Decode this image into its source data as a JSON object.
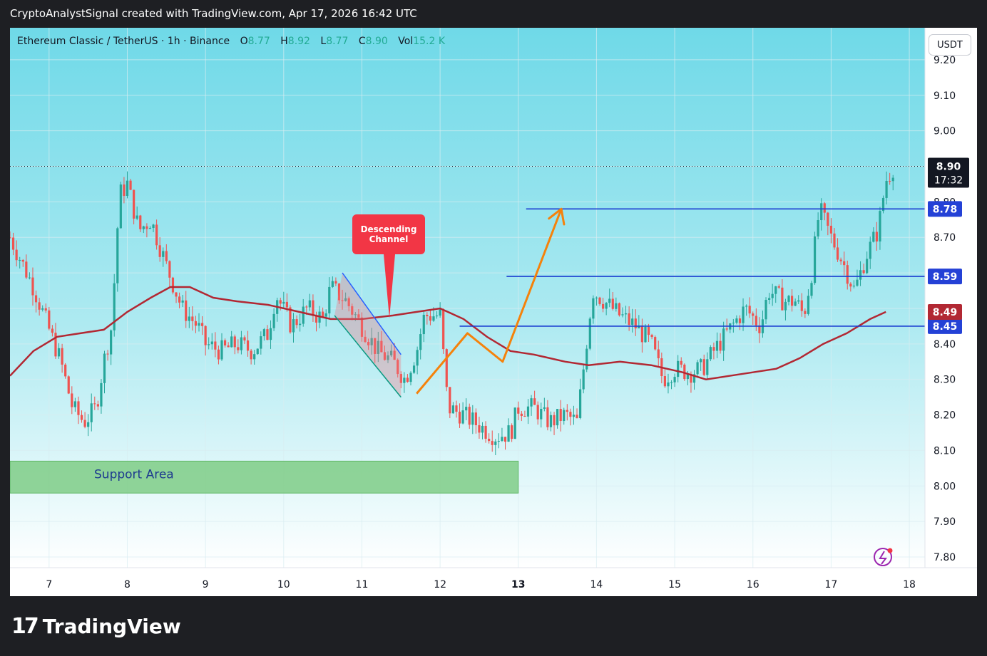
{
  "header": {
    "attribution": "CryptoAnalystSignal created with TradingView.com, Apr 17, 2026 16:42 UTC"
  },
  "legend": {
    "symbol": "Ethereum Classic / TetherUS · 1h · Binance",
    "o_label": "O",
    "o_value": "8.77",
    "h_label": "H",
    "h_value": "8.92",
    "l_label": "L",
    "l_value": "8.77",
    "c_label": "C",
    "c_value": "8.90",
    "vol_label": "Vol",
    "vol_value": "15.2 K"
  },
  "currency": "USDT",
  "logo": {
    "mark": "17",
    "text": "TradingView"
  },
  "colors": {
    "up": "#26a69a",
    "down": "#ef5350",
    "ma": "#b22833",
    "level": "#1c3fd1",
    "arrow": "#f5820b",
    "support": "#7fcc86",
    "bgTop": "#6fd9e8",
    "bgBottom": "#ffffff"
  },
  "chart_data": {
    "type": "candlestick",
    "ylim": [
      7.77,
      9.29
    ],
    "xlim": [
      6.5,
      18.2
    ],
    "y_ticks": [
      "9.20",
      "9.10",
      "9.00",
      "8.90",
      "8.80",
      "8.70",
      "8.60",
      "8.50",
      "8.40",
      "8.30",
      "8.20",
      "8.10",
      "8.00",
      "7.90",
      "7.80"
    ],
    "x_ticks": [
      {
        "x": 7,
        "label": "7"
      },
      {
        "x": 8,
        "label": "8"
      },
      {
        "x": 9,
        "label": "9"
      },
      {
        "x": 10,
        "label": "10"
      },
      {
        "x": 11,
        "label": "11"
      },
      {
        "x": 12,
        "label": "12"
      },
      {
        "x": 13,
        "label": "13"
      },
      {
        "x": 14,
        "label": "14"
      },
      {
        "x": 15,
        "label": "15"
      },
      {
        "x": 16,
        "label": "16"
      },
      {
        "x": 17,
        "label": "17"
      },
      {
        "x": 18,
        "label": "18"
      }
    ],
    "close_path": [
      [
        6.5,
        8.7
      ],
      [
        6.8,
        8.56
      ],
      [
        7.0,
        8.44
      ],
      [
        7.15,
        8.35
      ],
      [
        7.3,
        8.22
      ],
      [
        7.45,
        8.18
      ],
      [
        7.6,
        8.22
      ],
      [
        7.7,
        8.35
      ],
      [
        7.8,
        8.45
      ],
      [
        7.9,
        8.82
      ],
      [
        8.0,
        8.85
      ],
      [
        8.15,
        8.72
      ],
      [
        8.3,
        8.75
      ],
      [
        8.5,
        8.62
      ],
      [
        8.7,
        8.5
      ],
      [
        8.9,
        8.45
      ],
      [
        9.0,
        8.4
      ],
      [
        9.2,
        8.38
      ],
      [
        9.4,
        8.4
      ],
      [
        9.6,
        8.38
      ],
      [
        9.8,
        8.43
      ],
      [
        9.9,
        8.54
      ],
      [
        10.1,
        8.45
      ],
      [
        10.3,
        8.5
      ],
      [
        10.5,
        8.47
      ],
      [
        10.6,
        8.56
      ],
      [
        10.8,
        8.52
      ],
      [
        11.0,
        8.45
      ],
      [
        11.2,
        8.38
      ],
      [
        11.4,
        8.35
      ],
      [
        11.55,
        8.3
      ],
      [
        11.7,
        8.38
      ],
      [
        11.8,
        8.48
      ],
      [
        12.0,
        8.48
      ],
      [
        12.1,
        8.22
      ],
      [
        12.3,
        8.2
      ],
      [
        12.5,
        8.17
      ],
      [
        12.7,
        8.14
      ],
      [
        12.9,
        8.15
      ],
      [
        13.0,
        8.22
      ],
      [
        13.2,
        8.22
      ],
      [
        13.4,
        8.18
      ],
      [
        13.6,
        8.2
      ],
      [
        13.75,
        8.18
      ],
      [
        13.85,
        8.36
      ],
      [
        13.95,
        8.55
      ],
      [
        14.1,
        8.52
      ],
      [
        14.3,
        8.48
      ],
      [
        14.5,
        8.45
      ],
      [
        14.7,
        8.4
      ],
      [
        14.85,
        8.3
      ],
      [
        15.0,
        8.33
      ],
      [
        15.2,
        8.32
      ],
      [
        15.35,
        8.33
      ],
      [
        15.5,
        8.38
      ],
      [
        15.7,
        8.44
      ],
      [
        15.9,
        8.5
      ],
      [
        16.1,
        8.45
      ],
      [
        16.2,
        8.55
      ],
      [
        16.4,
        8.52
      ],
      [
        16.55,
        8.52
      ],
      [
        16.65,
        8.48
      ],
      [
        16.75,
        8.6
      ],
      [
        16.85,
        8.78
      ],
      [
        17.0,
        8.7
      ],
      [
        17.15,
        8.63
      ],
      [
        17.3,
        8.55
      ],
      [
        17.45,
        8.65
      ],
      [
        17.6,
        8.72
      ],
      [
        17.7,
        8.86
      ],
      [
        17.8,
        8.9
      ]
    ],
    "moving_average": [
      [
        6.5,
        8.31
      ],
      [
        6.8,
        8.38
      ],
      [
        7.1,
        8.42
      ],
      [
        7.4,
        8.43
      ],
      [
        7.7,
        8.44
      ],
      [
        8.0,
        8.49
      ],
      [
        8.3,
        8.53
      ],
      [
        8.55,
        8.56
      ],
      [
        8.8,
        8.56
      ],
      [
        9.1,
        8.53
      ],
      [
        9.4,
        8.52
      ],
      [
        9.8,
        8.51
      ],
      [
        10.2,
        8.49
      ],
      [
        10.6,
        8.47
      ],
      [
        11.0,
        8.47
      ],
      [
        11.4,
        8.48
      ],
      [
        11.7,
        8.49
      ],
      [
        12.0,
        8.5
      ],
      [
        12.3,
        8.47
      ],
      [
        12.6,
        8.42
      ],
      [
        12.9,
        8.38
      ],
      [
        13.2,
        8.37
      ],
      [
        13.6,
        8.35
      ],
      [
        13.9,
        8.34
      ],
      [
        14.3,
        8.35
      ],
      [
        14.7,
        8.34
      ],
      [
        15.1,
        8.32
      ],
      [
        15.4,
        8.3
      ],
      [
        15.7,
        8.31
      ],
      [
        16.0,
        8.32
      ],
      [
        16.3,
        8.33
      ],
      [
        16.6,
        8.36
      ],
      [
        16.9,
        8.4
      ],
      [
        17.2,
        8.43
      ],
      [
        17.5,
        8.47
      ],
      [
        17.7,
        8.49
      ]
    ],
    "levels": [
      {
        "price": 8.78,
        "x_start": 13.1,
        "label": "8.78"
      },
      {
        "price": 8.59,
        "x_start": 12.85,
        "label": "8.59"
      },
      {
        "price": 8.45,
        "x_start": 12.25,
        "label": "8.45"
      }
    ],
    "ma_label": "8.49",
    "last_price": {
      "label": "8.90",
      "countdown": "17:32",
      "price": 8.9
    },
    "support_zone": {
      "label": "Support Area",
      "y_low": 7.98,
      "y_high": 8.07,
      "x_start": 6.5,
      "x_end": 13.0
    },
    "descending_channel": {
      "label_line1": "Descending",
      "label_line2": "Channel",
      "upper": [
        [
          10.75,
          8.6
        ],
        [
          11.5,
          8.37
        ]
      ],
      "lower": [
        [
          10.65,
          8.48
        ],
        [
          11.5,
          8.25
        ]
      ]
    },
    "projection": [
      [
        11.7,
        8.26
      ],
      [
        12.35,
        8.43
      ],
      [
        12.8,
        8.35
      ],
      [
        13.55,
        8.78
      ]
    ]
  }
}
